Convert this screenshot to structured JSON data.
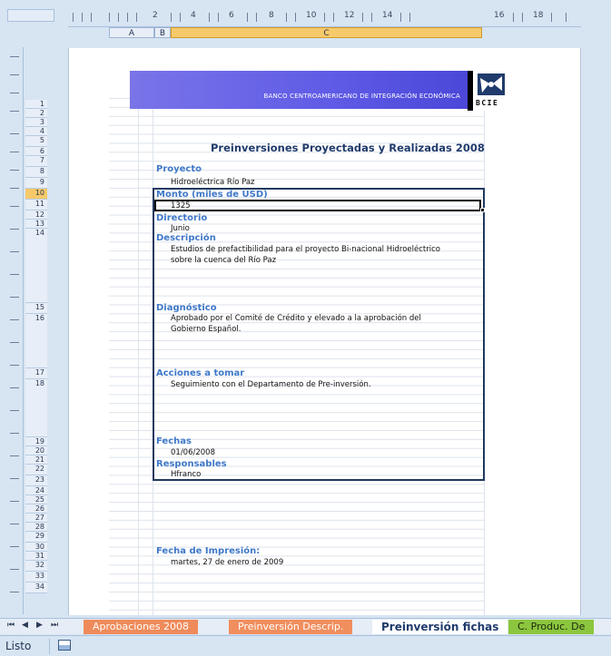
{
  "column_headers": [
    "A",
    "B",
    "C"
  ],
  "ruler_numbers": [
    "2",
    "4",
    "6",
    "8",
    "10",
    "12",
    "14",
    "16",
    "18"
  ],
  "row_numbers": [
    "1",
    "2",
    "3",
    "4",
    "5",
    "6",
    "7",
    "8",
    "9",
    "10",
    "11",
    "12",
    "13",
    "14",
    "15",
    "16",
    "17",
    "18",
    "19",
    "20",
    "21",
    "22",
    "23",
    "24",
    "25",
    "26",
    "27",
    "28",
    "29",
    "30",
    "31",
    "32",
    "33",
    "34"
  ],
  "banner": {
    "text": "BANCO CENTROAMERICANO DE INTEGRACIÓN ECONÓMICA",
    "logo_text": "BCIE"
  },
  "sheet": {
    "title": "Preinversiones Proyectadas y Realizadas 2008",
    "proyecto_label": "Proyecto",
    "proyecto_value": "Hidroeléctrica Río Paz",
    "monto_label": "Monto (miles de USD)",
    "monto_value": "1325",
    "directorio_label": "Directorio",
    "directorio_value": "Junio",
    "descripcion_label": "Descripción",
    "descripcion_line1": "Estudios de prefactibilidad para el proyecto Bi-nacional Hidroeléctrico",
    "descripcion_line2": "sobre la cuenca del Río Paz",
    "diagnostico_label": "Diagnóstico",
    "diagnostico_line1": "Aprobado por el Comité de Crédito y elevado a la aprobación del",
    "diagnostico_line2": "Gobierno Español.",
    "acciones_label": "Acciones a tomar",
    "acciones_value": "Seguimiento con el Departamento de Pre-inversión.",
    "fechas_label": "Fechas",
    "fechas_value": "01/06/2008",
    "responsables_label": "Responsables",
    "responsables_value": "Hfranco",
    "impresion_label": "Fecha de Impresión:",
    "impresion_value": "martes, 27 de enero de 2009"
  },
  "tabs": [
    "Aprobaciones 2008",
    "Preinversión Descrip.",
    "Preinversión fichas",
    "C. Produc. De"
  ],
  "status": {
    "text": "Listo"
  },
  "colors": {
    "banner": "#5f5be6",
    "section_label": "#3f78c8",
    "title": "#1f3b6b",
    "card_border": "#21395f"
  }
}
